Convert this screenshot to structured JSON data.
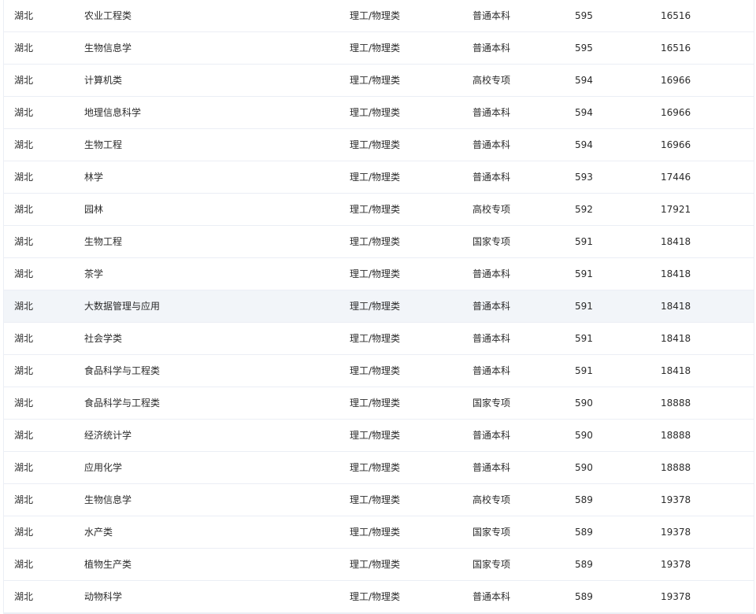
{
  "table": {
    "rows": [
      {
        "province": "湖北",
        "major": "农业工程类",
        "subject": "理工/物理类",
        "batch": "普通本科",
        "score": "595",
        "rank": "16516"
      },
      {
        "province": "湖北",
        "major": "生物信息学",
        "subject": "理工/物理类",
        "batch": "普通本科",
        "score": "595",
        "rank": "16516"
      },
      {
        "province": "湖北",
        "major": "计算机类",
        "subject": "理工/物理类",
        "batch": "高校专项",
        "score": "594",
        "rank": "16966"
      },
      {
        "province": "湖北",
        "major": "地理信息科学",
        "subject": "理工/物理类",
        "batch": "普通本科",
        "score": "594",
        "rank": "16966"
      },
      {
        "province": "湖北",
        "major": "生物工程",
        "subject": "理工/物理类",
        "batch": "普通本科",
        "score": "594",
        "rank": "16966"
      },
      {
        "province": "湖北",
        "major": "林学",
        "subject": "理工/物理类",
        "batch": "普通本科",
        "score": "593",
        "rank": "17446"
      },
      {
        "province": "湖北",
        "major": "园林",
        "subject": "理工/物理类",
        "batch": "高校专项",
        "score": "592",
        "rank": "17921"
      },
      {
        "province": "湖北",
        "major": "生物工程",
        "subject": "理工/物理类",
        "batch": "国家专项",
        "score": "591",
        "rank": "18418"
      },
      {
        "province": "湖北",
        "major": "茶学",
        "subject": "理工/物理类",
        "batch": "普通本科",
        "score": "591",
        "rank": "18418"
      },
      {
        "province": "湖北",
        "major": "大数据管理与应用",
        "subject": "理工/物理类",
        "batch": "普通本科",
        "score": "591",
        "rank": "18418"
      },
      {
        "province": "湖北",
        "major": "社会学类",
        "subject": "理工/物理类",
        "batch": "普通本科",
        "score": "591",
        "rank": "18418"
      },
      {
        "province": "湖北",
        "major": "食品科学与工程类",
        "subject": "理工/物理类",
        "batch": "普通本科",
        "score": "591",
        "rank": "18418"
      },
      {
        "province": "湖北",
        "major": "食品科学与工程类",
        "subject": "理工/物理类",
        "batch": "国家专项",
        "score": "590",
        "rank": "18888"
      },
      {
        "province": "湖北",
        "major": "经济统计学",
        "subject": "理工/物理类",
        "batch": "普通本科",
        "score": "590",
        "rank": "18888"
      },
      {
        "province": "湖北",
        "major": "应用化学",
        "subject": "理工/物理类",
        "batch": "普通本科",
        "score": "590",
        "rank": "18888"
      },
      {
        "province": "湖北",
        "major": "生物信息学",
        "subject": "理工/物理类",
        "batch": "高校专项",
        "score": "589",
        "rank": "19378"
      },
      {
        "province": "湖北",
        "major": "水产类",
        "subject": "理工/物理类",
        "batch": "国家专项",
        "score": "589",
        "rank": "19378"
      },
      {
        "province": "湖北",
        "major": "植物生产类",
        "subject": "理工/物理类",
        "batch": "国家专项",
        "score": "589",
        "rank": "19378"
      },
      {
        "province": "湖北",
        "major": "动物科学",
        "subject": "理工/物理类",
        "batch": "普通本科",
        "score": "589",
        "rank": "19378"
      }
    ],
    "hovered_row_index": 9
  },
  "colors": {
    "row_border": "#ebeef5",
    "hover_background": "#f2f5f9",
    "text": "#2b2b2b"
  }
}
